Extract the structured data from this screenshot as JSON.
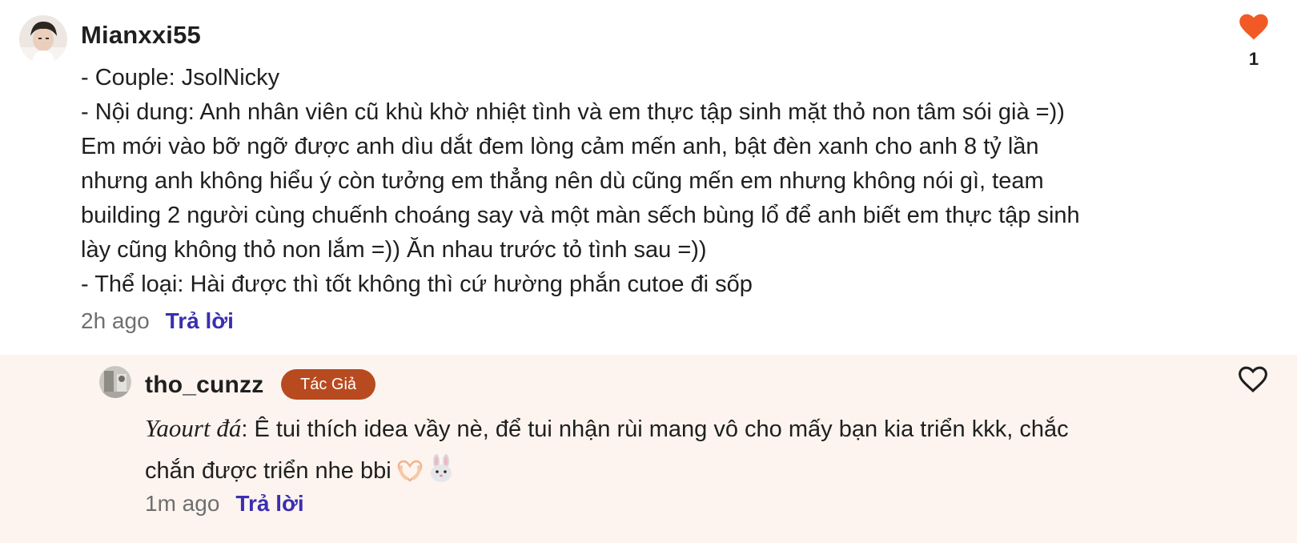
{
  "comment": {
    "username": "Mianxxi55",
    "avatar_icon": "user-avatar-photo",
    "lines": [
      "- Couple: JsolNicky",
      "- Nội dung: Anh nhân viên cũ khù khờ nhiệt tình và em thực tập sinh mặt thỏ non tâm sói già =))",
      "Em mới vào bỡ ngỡ được anh dìu dắt đem lòng cảm mến anh, bật đèn xanh cho anh 8 tỷ lần",
      "nhưng anh không hiểu ý còn tưởng em thẳng nên dù cũng mến em nhưng không nói gì, team",
      "building 2 người cùng chuếnh choáng say và một màn sếch bùng lổ để anh biết em thực tập sinh",
      "lày cũng không thỏ non lắm =)) Ăn nhau trước tỏ tình sau =))",
      "- Thể loại: Hài được thì tốt không thì cứ hường phắn cutoe đi sốp"
    ],
    "time": "2h ago",
    "reply_label": "Trả lời",
    "like_count": "1",
    "like_icon": "heart-filled-icon",
    "like_color": "#f15a24"
  },
  "reply": {
    "username": "tho_cunzz",
    "avatar_icon": "user-avatar-photo",
    "badge": "Tác Giả",
    "badge_color": "#b84a20",
    "mention": "Yaourt đá",
    "line1_rest": ": Ê tui thích idea vầy nè, để tui nhận rùi mang vô cho mấy bạn kia triển kkk, chắc",
    "line2": "chắn được triển nhe bbi",
    "emojis": [
      "heart-hands-emoji",
      "rabbit-face-emoji"
    ],
    "time": "1m ago",
    "reply_label": "Trả lời",
    "like_icon": "heart-outline-icon"
  },
  "colors": {
    "link": "#3a2fb0",
    "reply_background": "#fdf4ef"
  }
}
